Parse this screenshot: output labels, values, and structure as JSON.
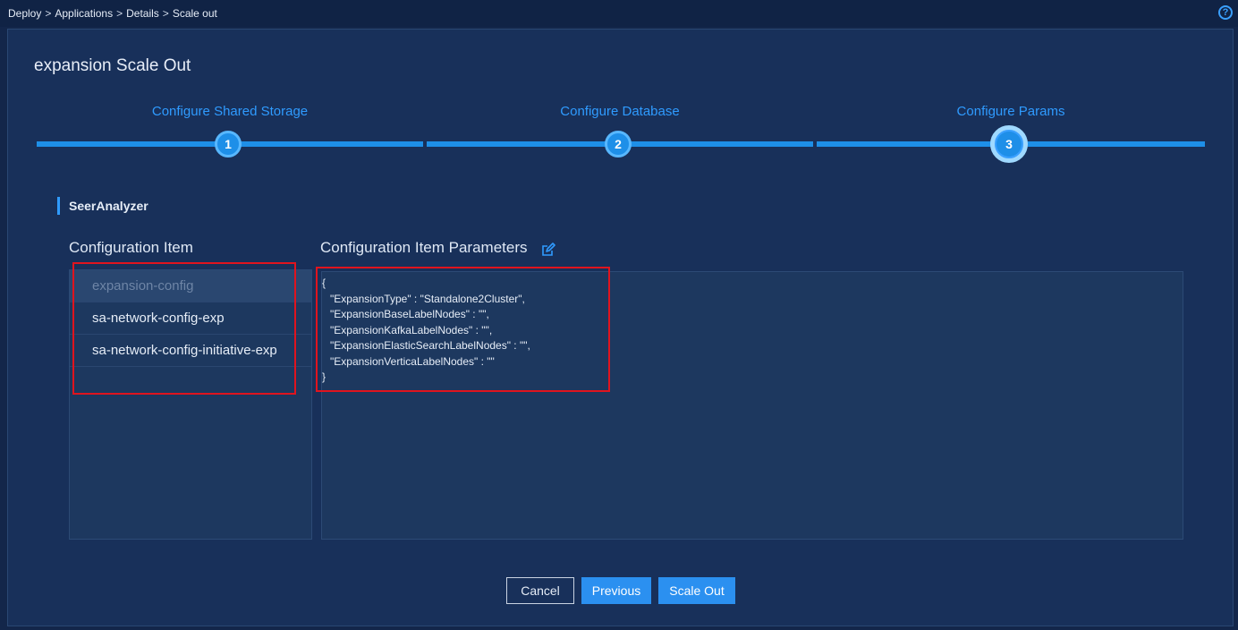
{
  "breadcrumb": {
    "items": [
      "Deploy",
      "Applications",
      "Details",
      "Scale out"
    ],
    "separator": ">"
  },
  "help_icon": "?",
  "panel": {
    "title": "expansion Scale Out"
  },
  "steps": [
    {
      "label": "Configure Shared Storage",
      "number": "1",
      "state": "done"
    },
    {
      "label": "Configure Database",
      "number": "2",
      "state": "done"
    },
    {
      "label": "Configure Params",
      "number": "3",
      "state": "active"
    }
  ],
  "section": {
    "title": "SeerAnalyzer"
  },
  "config_items": {
    "title": "Configuration Item",
    "items": [
      {
        "label": "expansion-config",
        "selected": true
      },
      {
        "label": "sa-network-config-exp",
        "selected": false
      },
      {
        "label": "sa-network-config-initiative-exp",
        "selected": false
      }
    ]
  },
  "config_params": {
    "title": "Configuration Item Parameters",
    "lines": [
      "{",
      "\"ExpansionType\" : \"Standalone2Cluster\",",
      "\"ExpansionBaseLabelNodes\" : \"\",",
      "\"ExpansionKafkaLabelNodes\" : \"\",",
      "\"ExpansionElasticSearchLabelNodes\" : \"\",",
      "\"ExpansionVerticaLabelNodes\" : \"\"",
      "}"
    ]
  },
  "buttons": {
    "cancel": "Cancel",
    "previous": "Previous",
    "scale_out": "Scale Out"
  },
  "colors": {
    "accent": "#2b90f0",
    "background": "#13264a",
    "panel": "#18305a",
    "highlight": "#e0141e"
  }
}
